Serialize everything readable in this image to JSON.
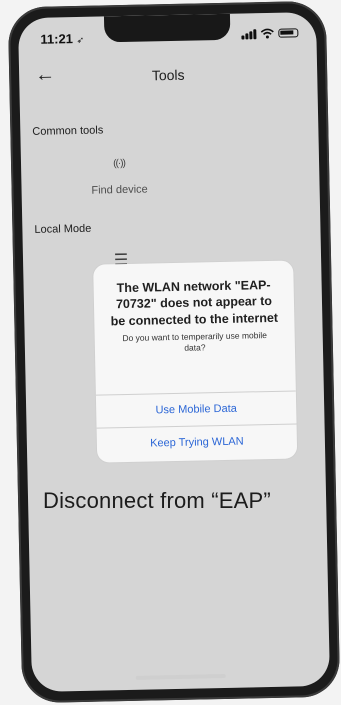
{
  "status_bar": {
    "time": "11:21",
    "location_glyph": "➶",
    "icons": [
      "signal-icon",
      "wifi-icon",
      "battery-icon"
    ]
  },
  "nav": {
    "back_glyph": "←",
    "title": "Tools"
  },
  "sections": {
    "common_tools": {
      "label": "Common tools",
      "items": [
        {
          "label": "Find device",
          "icon": "find-device-icon",
          "glyph": "((·))"
        }
      ]
    },
    "local_mode": {
      "label": "Local Mode",
      "items": [
        {
          "label": "",
          "icon": "settings-sliders-icon",
          "glyph": "☰"
        }
      ]
    }
  },
  "alert": {
    "title": "The WLAN network \"EAP-70732\" does not appear to be connected to the internet",
    "message": "Do you want to temperarily use mobile data?",
    "primary_button": "Use Mobile Data",
    "secondary_button": "Keep Trying WLAN"
  },
  "overlay_text": {
    "disconnect": "Disconnect from “EAP”"
  },
  "colors": {
    "alert_button": "#2b66d6",
    "screen_bg": "#e8e8e8",
    "phone_frame": "#1b1b1b"
  }
}
